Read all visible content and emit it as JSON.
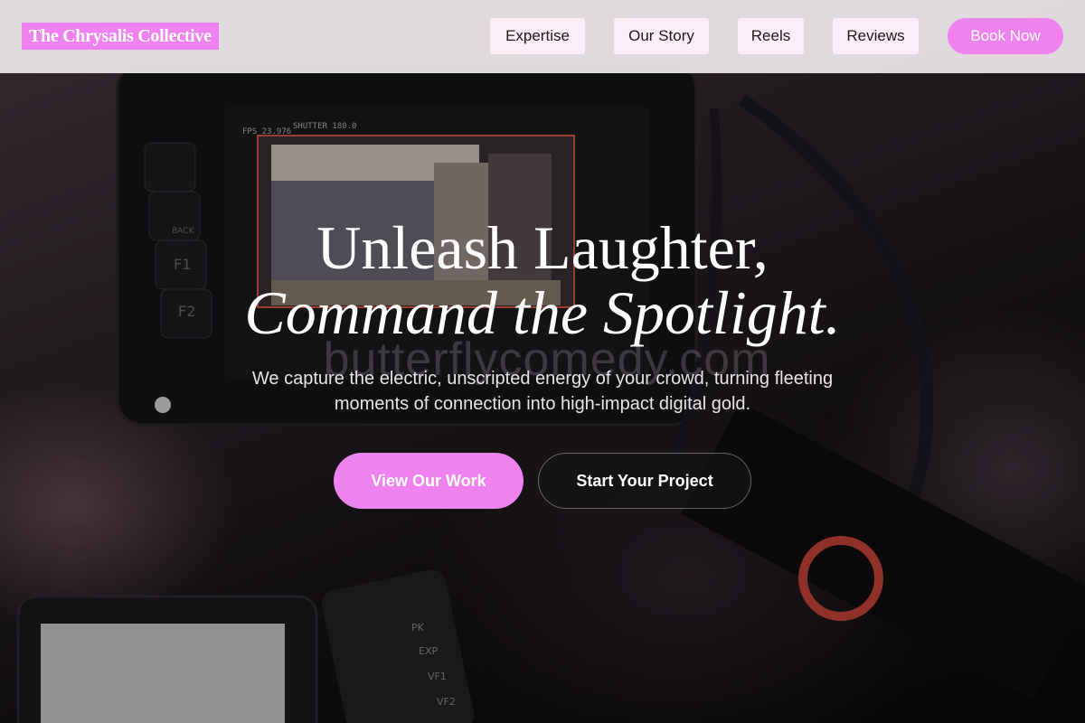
{
  "header": {
    "brand": "The Chrysalis Collective",
    "nav": [
      "Expertise",
      "Our Story",
      "Reels",
      "Reviews"
    ],
    "cta_label": "Book Now"
  },
  "hero": {
    "title_line1": "Unleash Laughter,",
    "title_line2": "Command the Spotlight.",
    "subtitle": "We capture the electric, unscripted energy of your crowd, turning fleeting moments of connection into high-impact digital gold.",
    "primary_cta": "View Our Work",
    "secondary_cta": "Start Your Project",
    "background_watermark": "butterflycomedy.com"
  },
  "monitor_readout": {
    "fps": "FPS 23.976",
    "shutter": "SHUTTER 180.0",
    "buttons": [
      "BACK",
      "F1",
      "F2"
    ],
    "recorder_buttons": [
      "PK",
      "EXP",
      "VF1",
      "VF2"
    ]
  },
  "colors": {
    "accent": "#ee82ee",
    "header_bg": "#eee8ec",
    "nav_button_bg": "#fbeef6",
    "secondary_button_bg": "#141416"
  }
}
